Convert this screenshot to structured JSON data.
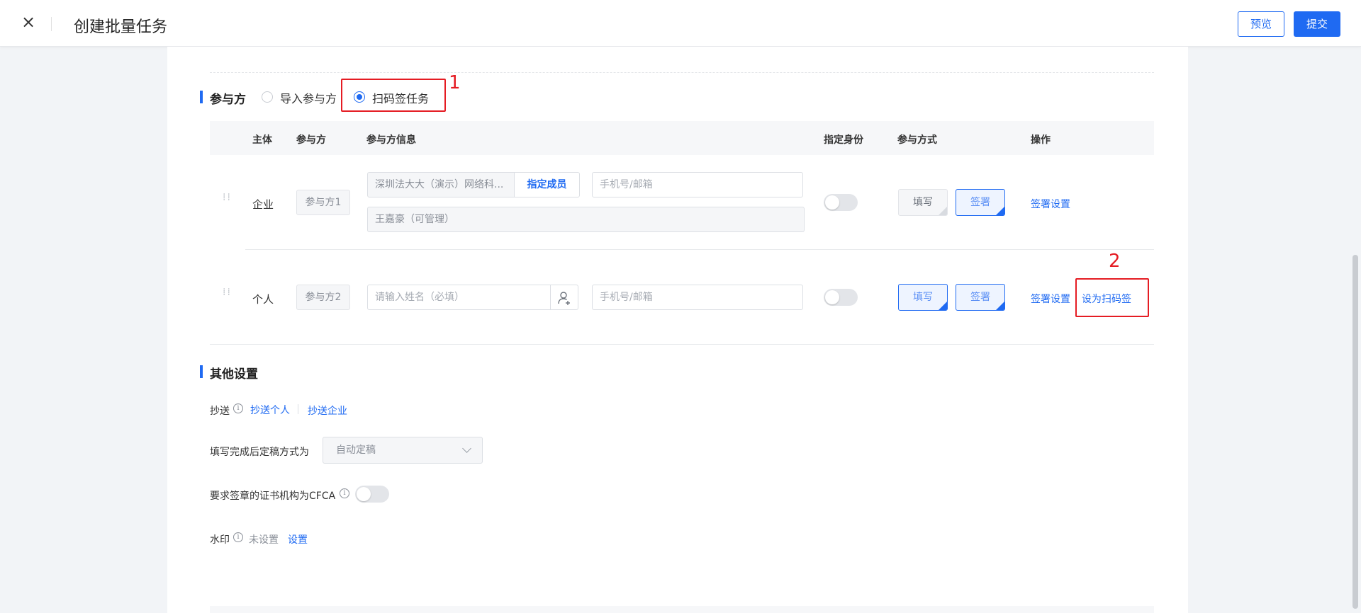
{
  "header": {
    "close_icon": "close-icon",
    "title": "创建批量任务",
    "preview_label": "预览",
    "submit_label": "提交"
  },
  "participants": {
    "section_title": "参与方",
    "radio_import": "导入参与方",
    "radio_scan": "扫码签任务",
    "selected": "扫码签任务",
    "annotation_1": "1",
    "annotation_2": "2",
    "columns": [
      "主体",
      "参与方",
      "参与方信息",
      "指定身份",
      "参与方式",
      "操作"
    ],
    "rows": [
      {
        "subject": "企业",
        "party": "参与方1",
        "company": "深圳法大大（演示）网络科...",
        "assign_member": "指定成员",
        "contact_placeholder": "手机号/邮箱",
        "member": "王嘉豪（可管理）",
        "identity_on": false,
        "fill_label": "填写",
        "sign_label": "签署",
        "sign_settings": "签署设置"
      },
      {
        "subject": "个人",
        "party": "参与方2",
        "name_placeholder": "请输入姓名（必填）",
        "contact_placeholder": "手机号/邮箱",
        "identity_on": false,
        "fill_label": "填写",
        "sign_label": "签署",
        "sign_settings": "签署设置",
        "set_scan": "设为扫码签"
      }
    ]
  },
  "other": {
    "section_title": "其他设置",
    "cc_label": "抄送",
    "cc_person": "抄送个人",
    "cc_company": "抄送企业",
    "finalize_label": "填写完成后定稿方式为",
    "finalize_value": "自动定稿",
    "cfca_label": "要求签章的证书机构为CFCA",
    "cfca_on": false,
    "watermark_label": "水印",
    "watermark_status": "未设置",
    "watermark_action": "设置"
  },
  "colors": {
    "accent": "#1f6af2",
    "annotation": "#e51c23"
  }
}
